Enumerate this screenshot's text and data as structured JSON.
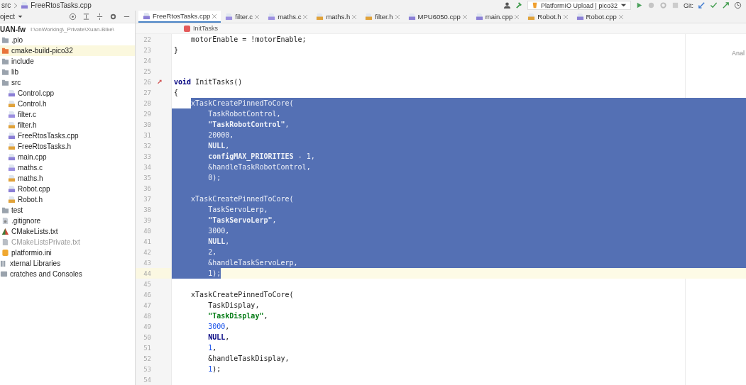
{
  "breadcrumb": {
    "folder": "src",
    "file": "FreeRtosTasks.cpp"
  },
  "toolbar": {
    "run_config": "PlatformIO Upload | pico32",
    "vcs_label": "Git:"
  },
  "project_panel": {
    "title": "oject",
    "root": {
      "label": "UAN-fw",
      "path": "I:\\onWorking\\_Private\\Xuan-Bike\\"
    },
    "items": [
      {
        "kind": "folder",
        "label": ".pio"
      },
      {
        "kind": "excluded-folder",
        "label": "cmake-build-pico32"
      },
      {
        "kind": "folder",
        "label": "include"
      },
      {
        "kind": "folder",
        "label": "lib"
      },
      {
        "kind": "folder",
        "label": "src",
        "children": [
          {
            "kind": "cpp",
            "label": "Control.cpp"
          },
          {
            "kind": "h",
            "label": "Control.h"
          },
          {
            "kind": "c",
            "label": "filter.c"
          },
          {
            "kind": "h",
            "label": "filter.h"
          },
          {
            "kind": "cpp",
            "label": "FreeRtosTasks.cpp"
          },
          {
            "kind": "h",
            "label": "FreeRtosTasks.h"
          },
          {
            "kind": "cpp",
            "label": "main.cpp"
          },
          {
            "kind": "c",
            "label": "maths.c"
          },
          {
            "kind": "h",
            "label": "maths.h"
          },
          {
            "kind": "cpp",
            "label": "Robot.cpp"
          },
          {
            "kind": "h",
            "label": "Robot.h"
          }
        ]
      },
      {
        "kind": "folder",
        "label": "test"
      },
      {
        "kind": "git",
        "label": ".gitignore"
      },
      {
        "kind": "cmake",
        "label": "CMakeLists.txt"
      },
      {
        "kind": "ignored-file",
        "label": "CMakeListsPrivate.txt"
      },
      {
        "kind": "ini",
        "label": "platformio.ini"
      },
      {
        "kind": "library",
        "label": "xternal Libraries"
      },
      {
        "kind": "scratch",
        "label": "cratches and Consoles"
      }
    ]
  },
  "tabs": [
    {
      "kind": "cpp",
      "label": "FreeRtosTasks.cpp",
      "selected": true
    },
    {
      "kind": "c",
      "label": "filter.c",
      "selected": false
    },
    {
      "kind": "c",
      "label": "maths.c",
      "selected": false
    },
    {
      "kind": "h",
      "label": "maths.h",
      "selected": false
    },
    {
      "kind": "h",
      "label": "filter.h",
      "selected": false
    },
    {
      "kind": "cpp",
      "label": "MPU6050.cpp",
      "selected": false
    },
    {
      "kind": "cpp",
      "label": "main.cpp",
      "selected": false
    },
    {
      "kind": "h",
      "label": "Robot.h",
      "selected": false
    },
    {
      "kind": "cpp",
      "label": "Robot.cpp",
      "selected": false
    }
  ],
  "editor": {
    "function_crumb": "InitTasks",
    "side_label": "Anal",
    "lines": [
      {
        "n": "22",
        "kind": "body",
        "gutter_icon": false,
        "selected": false,
        "current": false,
        "tokens": [
          {
            "kind": "plain",
            "text": "motorEnable = !motorEnable;"
          }
        ]
      },
      {
        "n": "23",
        "kind": "top",
        "gutter_icon": false,
        "selected": false,
        "current": false,
        "tokens": [
          {
            "kind": "plain",
            "text": "}"
          }
        ]
      },
      {
        "n": "24",
        "gutter_icon": false,
        "selected": false,
        "current": false
      },
      {
        "n": "25",
        "gutter_icon": false,
        "selected": false,
        "current": false
      },
      {
        "n": "26",
        "kind": "top",
        "gutter_icon": true,
        "selected": false,
        "current": false,
        "tokens": [
          {
            "kind": "keyword",
            "text": "void"
          },
          {
            "kind": "plain",
            "text": " InitTasks()"
          }
        ]
      },
      {
        "n": "27",
        "kind": "top",
        "gutter_icon": false,
        "selected": false,
        "current": false,
        "tokens": [
          {
            "kind": "plain",
            "text": "{"
          }
        ]
      },
      {
        "n": "28",
        "kind": "body",
        "gutter_icon": false,
        "selected": true,
        "clipped": true,
        "current": false,
        "tokens": [
          {
            "kind": "plain",
            "text": "xTaskCreatePinnedToCore("
          }
        ]
      },
      {
        "n": "29",
        "kind": "arg",
        "gutter_icon": false,
        "selected": true,
        "clipped": false,
        "current": false,
        "tokens": [
          {
            "kind": "plain",
            "text": "TaskRobotControl,"
          }
        ]
      },
      {
        "n": "30",
        "kind": "arg",
        "gutter_icon": false,
        "selected": true,
        "clipped": false,
        "current": false,
        "tokens": [
          {
            "kind": "string",
            "text": "\"TaskRobotControl\""
          },
          {
            "kind": "plain",
            "text": ","
          }
        ]
      },
      {
        "n": "31",
        "kind": "arg",
        "gutter_icon": false,
        "selected": true,
        "clipped": false,
        "current": false,
        "tokens": [
          {
            "kind": "number",
            "text": "20000"
          },
          {
            "kind": "plain",
            "text": ","
          }
        ]
      },
      {
        "n": "32",
        "kind": "arg",
        "gutter_icon": false,
        "selected": true,
        "clipped": false,
        "current": false,
        "tokens": [
          {
            "kind": "keyword",
            "text": "NULL"
          },
          {
            "kind": "plain",
            "text": ","
          }
        ]
      },
      {
        "n": "33",
        "kind": "arg",
        "gutter_icon": false,
        "selected": true,
        "clipped": false,
        "current": false,
        "tokens": [
          {
            "kind": "macro",
            "text": "configMAX_PRIORITIES"
          },
          {
            "kind": "plain",
            "text": " - "
          },
          {
            "kind": "number",
            "text": "1"
          },
          {
            "kind": "plain",
            "text": ","
          }
        ]
      },
      {
        "n": "34",
        "kind": "arg",
        "gutter_icon": false,
        "selected": true,
        "clipped": false,
        "current": false,
        "tokens": [
          {
            "kind": "plain",
            "text": "&handleTaskRobotControl,"
          }
        ]
      },
      {
        "n": "35",
        "kind": "arg",
        "gutter_icon": false,
        "selected": true,
        "clipped": false,
        "current": false,
        "tokens": [
          {
            "kind": "number",
            "text": "0"
          },
          {
            "kind": "plain",
            "text": ");"
          }
        ]
      },
      {
        "n": "36",
        "gutter_icon": false,
        "selected": true,
        "clipped": false,
        "current": false
      },
      {
        "n": "37",
        "kind": "body",
        "gutter_icon": false,
        "selected": true,
        "clipped": false,
        "current": false,
        "tokens": [
          {
            "kind": "plain",
            "text": "xTaskCreatePinnedToCore("
          }
        ]
      },
      {
        "n": "38",
        "kind": "arg",
        "gutter_icon": false,
        "selected": true,
        "clipped": false,
        "current": false,
        "tokens": [
          {
            "kind": "plain",
            "text": "TaskServoLerp,"
          }
        ]
      },
      {
        "n": "39",
        "kind": "arg",
        "gutter_icon": false,
        "selected": true,
        "clipped": false,
        "current": false,
        "tokens": [
          {
            "kind": "string",
            "text": "\"TaskServoLerp\""
          },
          {
            "kind": "plain",
            "text": ","
          }
        ]
      },
      {
        "n": "40",
        "kind": "arg",
        "gutter_icon": false,
        "selected": true,
        "clipped": false,
        "current": false,
        "tokens": [
          {
            "kind": "number",
            "text": "3000"
          },
          {
            "kind": "plain",
            "text": ","
          }
        ]
      },
      {
        "n": "41",
        "kind": "arg",
        "gutter_icon": false,
        "selected": true,
        "clipped": false,
        "current": false,
        "tokens": [
          {
            "kind": "keyword",
            "text": "NULL"
          },
          {
            "kind": "plain",
            "text": ","
          }
        ]
      },
      {
        "n": "42",
        "kind": "arg",
        "gutter_icon": false,
        "selected": true,
        "clipped": false,
        "current": false,
        "tokens": [
          {
            "kind": "number",
            "text": "2"
          },
          {
            "kind": "plain",
            "text": ","
          }
        ]
      },
      {
        "n": "43",
        "kind": "arg",
        "gutter_icon": false,
        "selected": true,
        "clipped": false,
        "current": false,
        "tokens": [
          {
            "kind": "plain",
            "text": "&handleTaskServoLerp,"
          }
        ]
      },
      {
        "n": "44",
        "kind": "arg",
        "gutter_icon": false,
        "selected": true,
        "clipped": true,
        "current": true,
        "tokens": [
          {
            "kind": "number",
            "text": "1"
          },
          {
            "kind": "plain",
            "text": ");"
          }
        ]
      },
      {
        "n": "45",
        "gutter_icon": false,
        "selected": false,
        "current": false
      },
      {
        "n": "46",
        "kind": "body",
        "gutter_icon": false,
        "selected": false,
        "current": false,
        "tokens": [
          {
            "kind": "plain",
            "text": "xTaskCreatePinnedToCore("
          }
        ]
      },
      {
        "n": "47",
        "kind": "arg",
        "gutter_icon": false,
        "selected": false,
        "current": false,
        "tokens": [
          {
            "kind": "plain",
            "text": "TaskDisplay,"
          }
        ]
      },
      {
        "n": "48",
        "kind": "arg",
        "gutter_icon": false,
        "selected": false,
        "current": false,
        "tokens": [
          {
            "kind": "string",
            "text": "\"TaskDisplay\""
          },
          {
            "kind": "plain",
            "text": ","
          }
        ]
      },
      {
        "n": "49",
        "kind": "arg",
        "gutter_icon": false,
        "selected": false,
        "current": false,
        "tokens": [
          {
            "kind": "number",
            "text": "3000"
          },
          {
            "kind": "plain",
            "text": ","
          }
        ]
      },
      {
        "n": "50",
        "kind": "arg",
        "gutter_icon": false,
        "selected": false,
        "current": false,
        "tokens": [
          {
            "kind": "keyword",
            "text": "NULL"
          },
          {
            "kind": "plain",
            "text": ","
          }
        ]
      },
      {
        "n": "51",
        "kind": "arg",
        "gutter_icon": false,
        "selected": false,
        "current": false,
        "tokens": [
          {
            "kind": "number",
            "text": "1"
          },
          {
            "kind": "plain",
            "text": ","
          }
        ]
      },
      {
        "n": "52",
        "kind": "arg",
        "gutter_icon": false,
        "selected": false,
        "current": false,
        "tokens": [
          {
            "kind": "plain",
            "text": "&handleTaskDisplay,"
          }
        ]
      },
      {
        "n": "53",
        "kind": "arg",
        "gutter_icon": false,
        "selected": false,
        "current": false,
        "tokens": [
          {
            "kind": "number",
            "text": "1"
          },
          {
            "kind": "plain",
            "text": ");"
          }
        ]
      },
      {
        "n": "54",
        "gutter_icon": false,
        "selected": false,
        "current": false
      }
    ]
  }
}
